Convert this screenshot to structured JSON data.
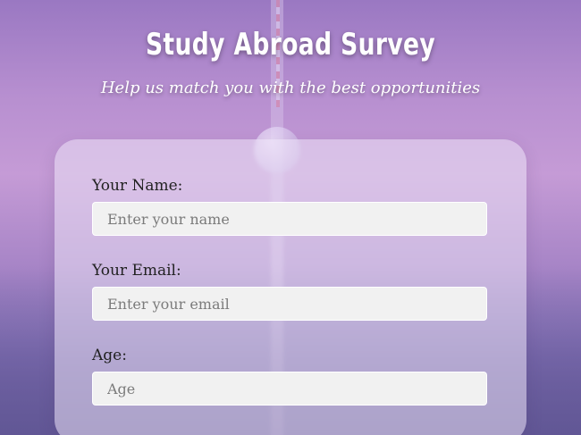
{
  "header": {
    "title": "Study Abroad Survey",
    "subtitle": "Help us match you with the best opportunities"
  },
  "form": {
    "name": {
      "label": "Your Name:",
      "placeholder": "Enter your name",
      "value": ""
    },
    "email": {
      "label": "Your Email:",
      "placeholder": "Enter your email",
      "value": ""
    },
    "age": {
      "label": "Age:",
      "placeholder": "Age",
      "value": ""
    }
  },
  "colors": {
    "background_top": "#9a78c2",
    "background_bottom": "#6e6ca6",
    "card_tint": "#ebe1f5",
    "input_bg": "#f1f1f1",
    "label_text": "#222222",
    "placeholder_text": "#7b7b7b",
    "title_text": "#ffffff"
  }
}
